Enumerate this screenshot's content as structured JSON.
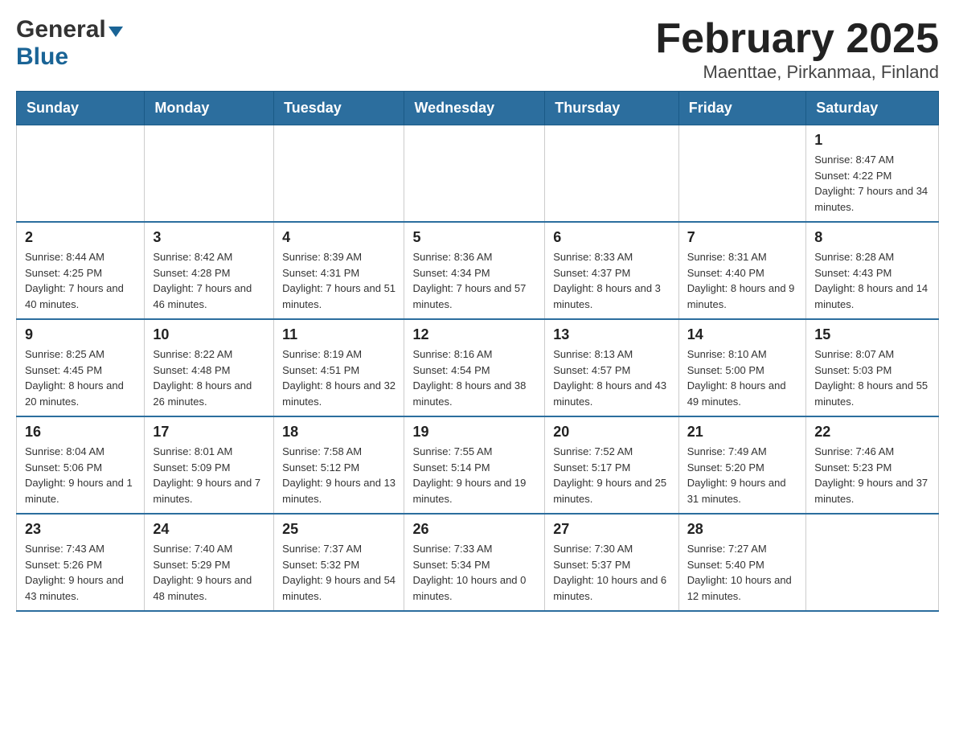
{
  "header": {
    "logo": {
      "general": "General",
      "blue": "Blue"
    },
    "title": "February 2025",
    "subtitle": "Maenttae, Pirkanmaa, Finland"
  },
  "weekdays": [
    "Sunday",
    "Monday",
    "Tuesday",
    "Wednesday",
    "Thursday",
    "Friday",
    "Saturday"
  ],
  "weeks": [
    [
      {
        "day": "",
        "sunrise": "",
        "sunset": "",
        "daylight": ""
      },
      {
        "day": "",
        "sunrise": "",
        "sunset": "",
        "daylight": ""
      },
      {
        "day": "",
        "sunrise": "",
        "sunset": "",
        "daylight": ""
      },
      {
        "day": "",
        "sunrise": "",
        "sunset": "",
        "daylight": ""
      },
      {
        "day": "",
        "sunrise": "",
        "sunset": "",
        "daylight": ""
      },
      {
        "day": "",
        "sunrise": "",
        "sunset": "",
        "daylight": ""
      },
      {
        "day": "1",
        "sunrise": "Sunrise: 8:47 AM",
        "sunset": "Sunset: 4:22 PM",
        "daylight": "Daylight: 7 hours and 34 minutes."
      }
    ],
    [
      {
        "day": "2",
        "sunrise": "Sunrise: 8:44 AM",
        "sunset": "Sunset: 4:25 PM",
        "daylight": "Daylight: 7 hours and 40 minutes."
      },
      {
        "day": "3",
        "sunrise": "Sunrise: 8:42 AM",
        "sunset": "Sunset: 4:28 PM",
        "daylight": "Daylight: 7 hours and 46 minutes."
      },
      {
        "day": "4",
        "sunrise": "Sunrise: 8:39 AM",
        "sunset": "Sunset: 4:31 PM",
        "daylight": "Daylight: 7 hours and 51 minutes."
      },
      {
        "day": "5",
        "sunrise": "Sunrise: 8:36 AM",
        "sunset": "Sunset: 4:34 PM",
        "daylight": "Daylight: 7 hours and 57 minutes."
      },
      {
        "day": "6",
        "sunrise": "Sunrise: 8:33 AM",
        "sunset": "Sunset: 4:37 PM",
        "daylight": "Daylight: 8 hours and 3 minutes."
      },
      {
        "day": "7",
        "sunrise": "Sunrise: 8:31 AM",
        "sunset": "Sunset: 4:40 PM",
        "daylight": "Daylight: 8 hours and 9 minutes."
      },
      {
        "day": "8",
        "sunrise": "Sunrise: 8:28 AM",
        "sunset": "Sunset: 4:43 PM",
        "daylight": "Daylight: 8 hours and 14 minutes."
      }
    ],
    [
      {
        "day": "9",
        "sunrise": "Sunrise: 8:25 AM",
        "sunset": "Sunset: 4:45 PM",
        "daylight": "Daylight: 8 hours and 20 minutes."
      },
      {
        "day": "10",
        "sunrise": "Sunrise: 8:22 AM",
        "sunset": "Sunset: 4:48 PM",
        "daylight": "Daylight: 8 hours and 26 minutes."
      },
      {
        "day": "11",
        "sunrise": "Sunrise: 8:19 AM",
        "sunset": "Sunset: 4:51 PM",
        "daylight": "Daylight: 8 hours and 32 minutes."
      },
      {
        "day": "12",
        "sunrise": "Sunrise: 8:16 AM",
        "sunset": "Sunset: 4:54 PM",
        "daylight": "Daylight: 8 hours and 38 minutes."
      },
      {
        "day": "13",
        "sunrise": "Sunrise: 8:13 AM",
        "sunset": "Sunset: 4:57 PM",
        "daylight": "Daylight: 8 hours and 43 minutes."
      },
      {
        "day": "14",
        "sunrise": "Sunrise: 8:10 AM",
        "sunset": "Sunset: 5:00 PM",
        "daylight": "Daylight: 8 hours and 49 minutes."
      },
      {
        "day": "15",
        "sunrise": "Sunrise: 8:07 AM",
        "sunset": "Sunset: 5:03 PM",
        "daylight": "Daylight: 8 hours and 55 minutes."
      }
    ],
    [
      {
        "day": "16",
        "sunrise": "Sunrise: 8:04 AM",
        "sunset": "Sunset: 5:06 PM",
        "daylight": "Daylight: 9 hours and 1 minute."
      },
      {
        "day": "17",
        "sunrise": "Sunrise: 8:01 AM",
        "sunset": "Sunset: 5:09 PM",
        "daylight": "Daylight: 9 hours and 7 minutes."
      },
      {
        "day": "18",
        "sunrise": "Sunrise: 7:58 AM",
        "sunset": "Sunset: 5:12 PM",
        "daylight": "Daylight: 9 hours and 13 minutes."
      },
      {
        "day": "19",
        "sunrise": "Sunrise: 7:55 AM",
        "sunset": "Sunset: 5:14 PM",
        "daylight": "Daylight: 9 hours and 19 minutes."
      },
      {
        "day": "20",
        "sunrise": "Sunrise: 7:52 AM",
        "sunset": "Sunset: 5:17 PM",
        "daylight": "Daylight: 9 hours and 25 minutes."
      },
      {
        "day": "21",
        "sunrise": "Sunrise: 7:49 AM",
        "sunset": "Sunset: 5:20 PM",
        "daylight": "Daylight: 9 hours and 31 minutes."
      },
      {
        "day": "22",
        "sunrise": "Sunrise: 7:46 AM",
        "sunset": "Sunset: 5:23 PM",
        "daylight": "Daylight: 9 hours and 37 minutes."
      }
    ],
    [
      {
        "day": "23",
        "sunrise": "Sunrise: 7:43 AM",
        "sunset": "Sunset: 5:26 PM",
        "daylight": "Daylight: 9 hours and 43 minutes."
      },
      {
        "day": "24",
        "sunrise": "Sunrise: 7:40 AM",
        "sunset": "Sunset: 5:29 PM",
        "daylight": "Daylight: 9 hours and 48 minutes."
      },
      {
        "day": "25",
        "sunrise": "Sunrise: 7:37 AM",
        "sunset": "Sunset: 5:32 PM",
        "daylight": "Daylight: 9 hours and 54 minutes."
      },
      {
        "day": "26",
        "sunrise": "Sunrise: 7:33 AM",
        "sunset": "Sunset: 5:34 PM",
        "daylight": "Daylight: 10 hours and 0 minutes."
      },
      {
        "day": "27",
        "sunrise": "Sunrise: 7:30 AM",
        "sunset": "Sunset: 5:37 PM",
        "daylight": "Daylight: 10 hours and 6 minutes."
      },
      {
        "day": "28",
        "sunrise": "Sunrise: 7:27 AM",
        "sunset": "Sunset: 5:40 PM",
        "daylight": "Daylight: 10 hours and 12 minutes."
      },
      {
        "day": "",
        "sunrise": "",
        "sunset": "",
        "daylight": ""
      }
    ]
  ]
}
